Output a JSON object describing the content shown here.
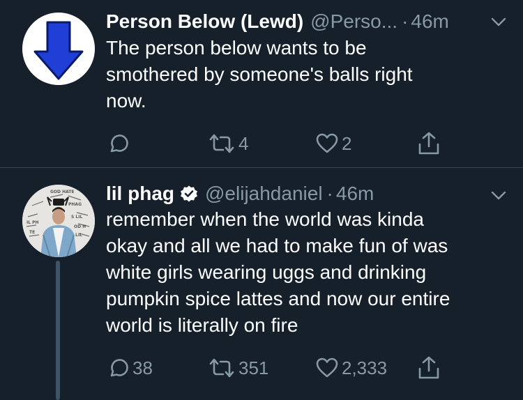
{
  "tweets": [
    {
      "name": "Person Below (Lewd)",
      "handle": "@Perso...",
      "separator": "·",
      "time": "46m",
      "text_lines": [
        "The person below wants to be",
        "smothered by someone's balls right",
        "now."
      ],
      "replies": "",
      "retweets": "4",
      "likes": "2",
      "avatar_icon": "blue-down-arrow-icon",
      "verified": false
    },
    {
      "name": "lil phag",
      "handle": "@elijahdaniel",
      "separator": "·",
      "time": "46m",
      "text_lines": [
        "remember when the world was kinda",
        "okay and all we had to make fun of was",
        "white girls wearing uggs and drinking",
        "pumpkin spice lattes and now our entire",
        "world is literally on fire"
      ],
      "replies": "38",
      "retweets": "351",
      "likes": "2,333",
      "avatar_icon": "profile-photo",
      "verified": true
    }
  ],
  "colors": {
    "background": "#15202b",
    "text": "#ffffff",
    "secondary": "#8899a6",
    "divider": "#38444d",
    "arrow_fill": "#1f3fd6",
    "verified_badge": "#ffffff"
  }
}
